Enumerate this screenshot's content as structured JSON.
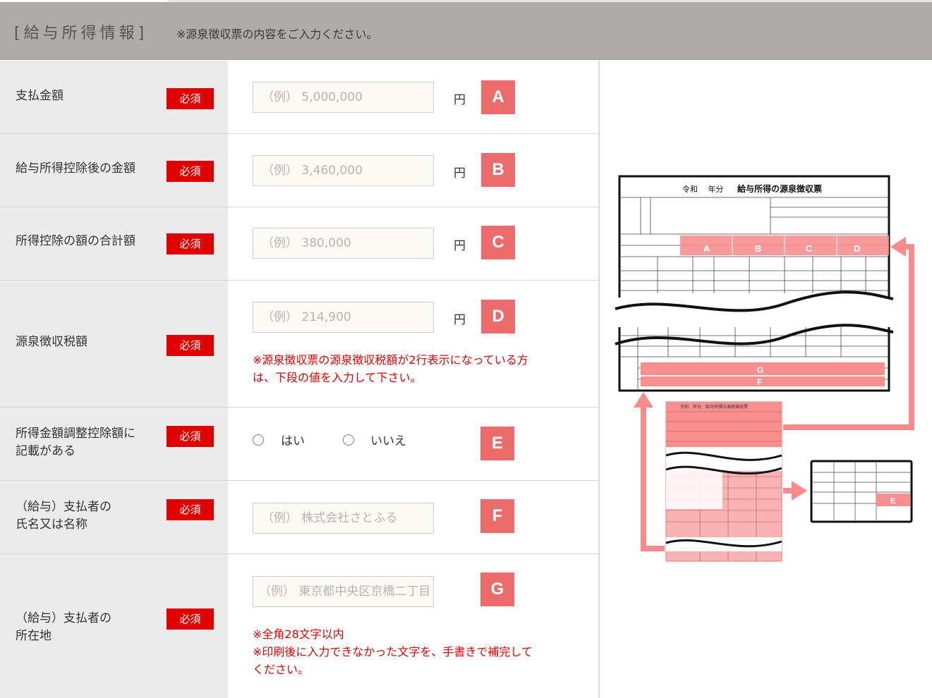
{
  "header": {
    "title": "[給与所得情報]",
    "note": "※源泉徴収票の内容をご入力ください。"
  },
  "required_label": "必須",
  "yen": "円",
  "rows": [
    {
      "label": "支払金額",
      "placeholder": "（例） 5,000,000",
      "badge": "A"
    },
    {
      "label": "給与所得控除後の金額",
      "placeholder": "（例） 3,460,000",
      "badge": "B"
    },
    {
      "label": "所得控除の額の合計額",
      "placeholder": "（例） 380,000",
      "badge": "C"
    },
    {
      "label": "源泉徴収税額",
      "placeholder": "（例） 214,900",
      "badge": "D",
      "note_line1": "※源泉徴収票の源泉徴収税額が2行表示になっている方",
      "note_line2": "は、下段の値を入力して下さい。"
    },
    {
      "label_line1": "所得金額調整控除額に",
      "label_line2": "記載がある",
      "badge": "E",
      "option_yes": "はい",
      "option_no": "いいえ"
    },
    {
      "label_line1": "（給与）支払者の",
      "label_line2": "氏名又は名称",
      "placeholder": "（例） 株式会社さとふる",
      "badge": "F"
    },
    {
      "label_line1": "（給与）支払者の",
      "label_line2": "所在地",
      "placeholder": "（例） 東京都中央区京橋二丁目",
      "badge": "G",
      "note_line1": "※全角28文字以内",
      "note_line2": "※印刷後に入力できなかった文字を、手書きで補完して",
      "note_line3": "ください。"
    }
  ],
  "diagram": {
    "form_title": "給与所得の源泉徴収票",
    "era": "令和　 年分",
    "small_title": "令和　年分　給与所得の源泉徴収票",
    "letters": [
      "A",
      "B",
      "C",
      "D",
      "E",
      "F",
      "G"
    ],
    "colors": {
      "pink": "#f78f8f",
      "pink_light": "#f9b3b3",
      "arrow": "#f78a8a",
      "red_req": "#e00000",
      "badge": "#ec6b6b"
    }
  }
}
